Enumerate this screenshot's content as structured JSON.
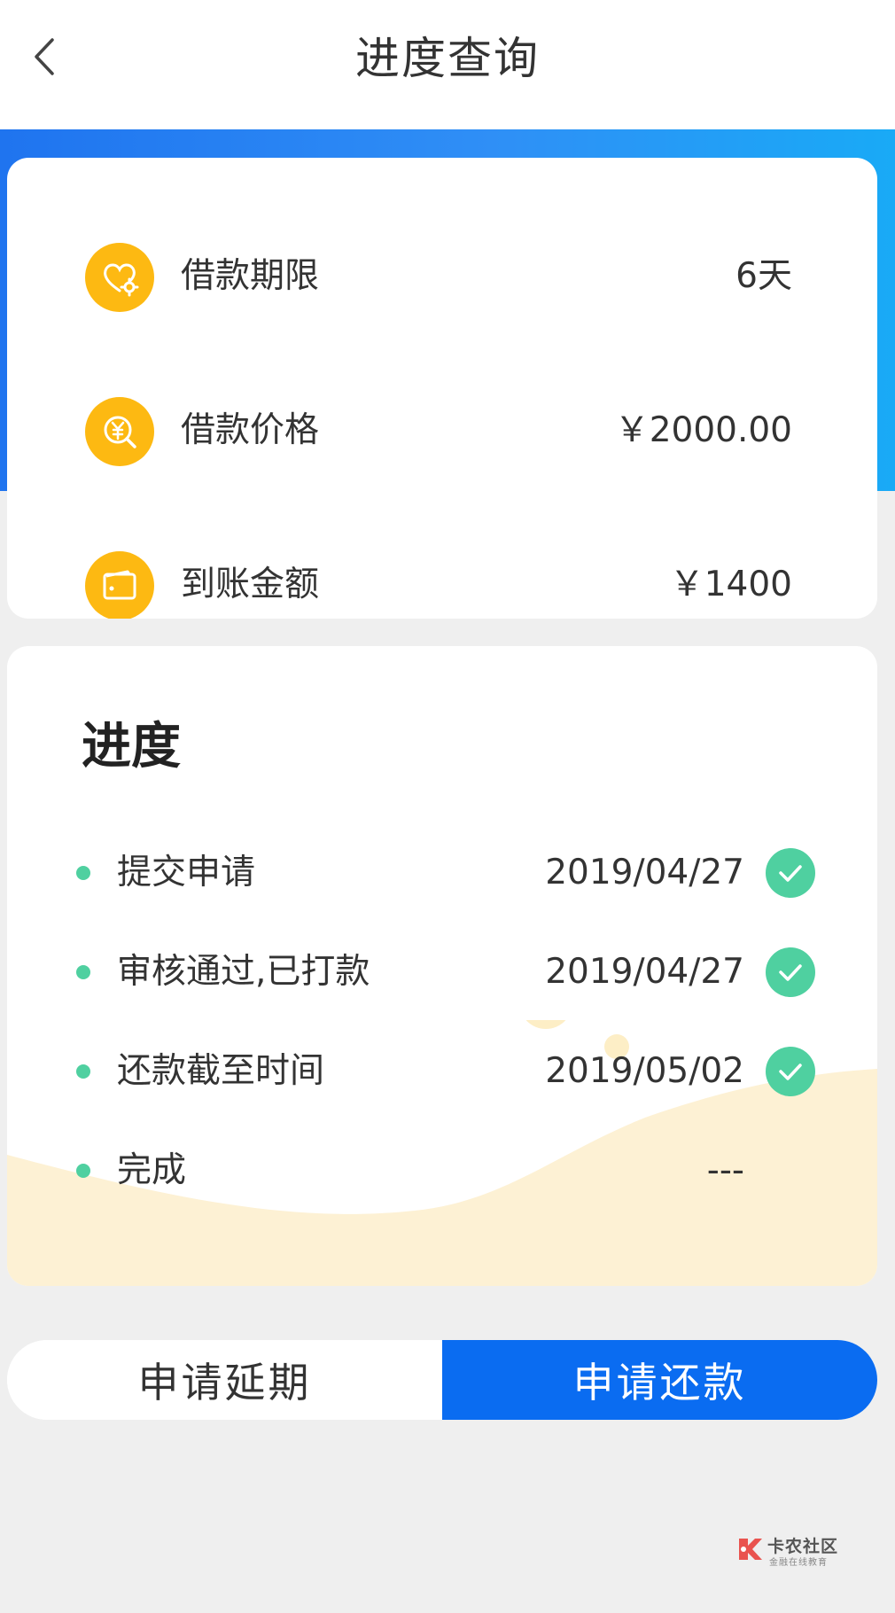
{
  "header": {
    "title": "进度查询"
  },
  "loan_info": [
    {
      "label": "借款期限",
      "value": "6天",
      "icon": "heart-gear-icon"
    },
    {
      "label": "借款价格",
      "value": "￥2000.00",
      "icon": "yuan-search-icon"
    },
    {
      "label": "到账金额",
      "value": "￥1400",
      "icon": "wallet-icon"
    }
  ],
  "progress": {
    "title": "进度",
    "steps": [
      {
        "label": "提交申请",
        "date": "2019/04/27",
        "done": true
      },
      {
        "label": "审核通过,已打款",
        "date": "2019/04/27",
        "done": true
      },
      {
        "label": "还款截至时间",
        "date": "2019/05/02",
        "done": true
      },
      {
        "label": "完成",
        "date": "---",
        "done": false
      }
    ]
  },
  "actions": {
    "extend_label": "申请延期",
    "repay_label": "申请还款"
  },
  "watermark": {
    "name": "卡农社区",
    "sub": "金融在线教育"
  },
  "colors": {
    "accent_blue": "#0a6cf1",
    "icon_yellow": "#fdb912",
    "success_green": "#4fd0a0",
    "wave_cream": "#fdf1d4"
  }
}
